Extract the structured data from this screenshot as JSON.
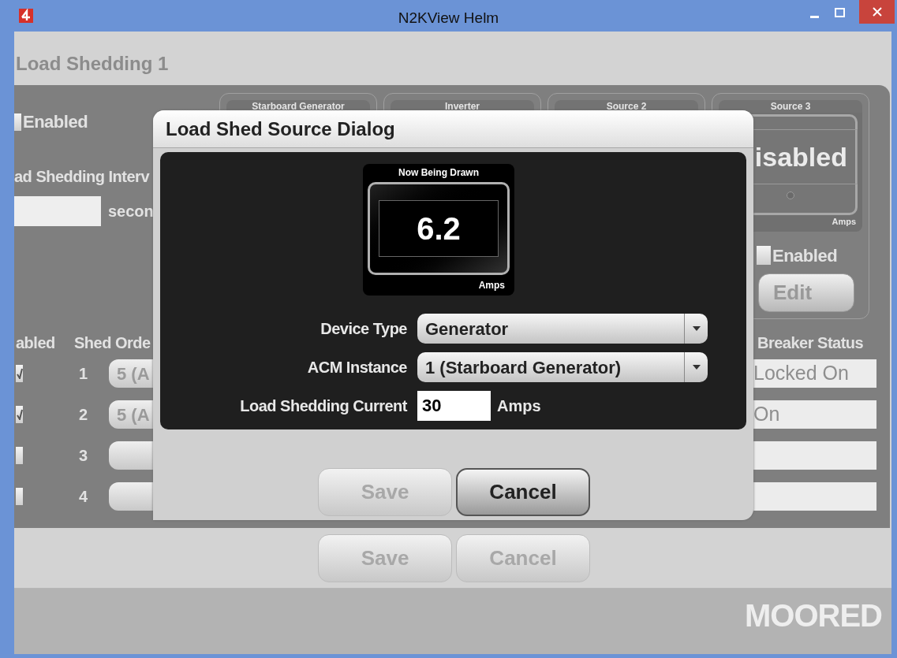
{
  "window": {
    "title": "N2KView Helm"
  },
  "page": {
    "title": "Load Shedding 1",
    "enabled": {
      "label": "Enabled",
      "checked": false
    },
    "interval": {
      "label": "ad Shedding Interv",
      "unit": "secon"
    }
  },
  "sources": [
    {
      "title": "Starboard Generator"
    },
    {
      "title": "Inverter"
    },
    {
      "title": "Source 2"
    },
    {
      "title": "Source 3",
      "reading": "isabled",
      "unit": "Amps",
      "enabled": {
        "label": "Enabled",
        "checked": false
      },
      "edit_button": "Edit"
    }
  ],
  "table": {
    "columns": [
      "abled",
      "Shed Orde",
      "Breaker Status"
    ],
    "rows": [
      {
        "checked": true,
        "order": "1",
        "select": "5 (A",
        "breaker": "Locked On"
      },
      {
        "checked": true,
        "order": "2",
        "select": "5 (A",
        "breaker": "On"
      },
      {
        "checked": false,
        "order": "3"
      },
      {
        "checked": false,
        "order": "4"
      }
    ]
  },
  "footer": {
    "buttons": [
      {
        "label": "Save",
        "disabled": true
      },
      {
        "label": "Cancel",
        "disabled": true
      }
    ]
  },
  "status_bar": {
    "mode": "MOORED"
  },
  "dialog": {
    "title": "Load Shed Source Dialog",
    "gauge": {
      "title": "Now Being Drawn",
      "value": "6.2",
      "unit": "Amps"
    },
    "fields": [
      {
        "kind": "select",
        "label": "Device Type",
        "value": "Generator"
      },
      {
        "kind": "select",
        "label": "ACM Instance",
        "value": "1 (Starboard Generator)"
      },
      {
        "kind": "input",
        "label": "Load Shedding Current",
        "value": "30",
        "unit": "Amps"
      }
    ],
    "buttons": [
      {
        "label": "Save",
        "disabled": true
      },
      {
        "label": "Cancel",
        "disabled": false
      }
    ]
  }
}
